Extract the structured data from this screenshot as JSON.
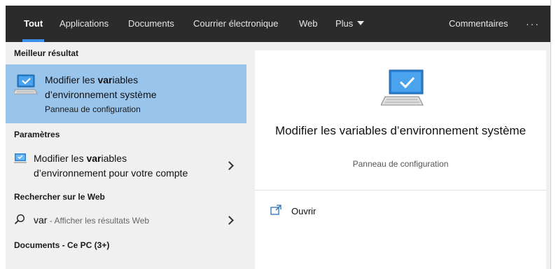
{
  "tabs": [
    {
      "label": "Tout",
      "active": true
    },
    {
      "label": "Applications"
    },
    {
      "label": "Documents"
    },
    {
      "label": "Courrier électronique"
    },
    {
      "label": "Web"
    },
    {
      "label": "Plus"
    }
  ],
  "header_right": {
    "feedback": "Commentaires",
    "more": "···"
  },
  "best_match": {
    "section": "Meilleur résultat",
    "title_line1_pre": "Modifier les ",
    "title_line1_bold": "var",
    "title_line1_post": "iables",
    "title_line2": "d’environnement système",
    "subtitle": "Panneau de configuration",
    "icon": "monitor-check-icon"
  },
  "settings": {
    "section": "Paramètres",
    "title_pre": "Modifier les ",
    "title_bold": "var",
    "title_post": "iables",
    "title_line2": "d’environnement pour votre compte",
    "icon": "settings-monitor-icon"
  },
  "web": {
    "section": "Rechercher sur le Web",
    "query": "var",
    "hint": " - Afficher les résultats Web",
    "icon": "search-icon"
  },
  "documents": {
    "section": "Documents - Ce PC (3+)"
  },
  "preview": {
    "title": "Modifier les variables d’environnement système",
    "subtitle": "Panneau de configuration",
    "action_open": "Ouvrir",
    "icon": "monitor-check-icon"
  },
  "colors": {
    "accent": "#3c8ee8",
    "selected": "#99c4ec",
    "header": "#2b2b2b"
  }
}
